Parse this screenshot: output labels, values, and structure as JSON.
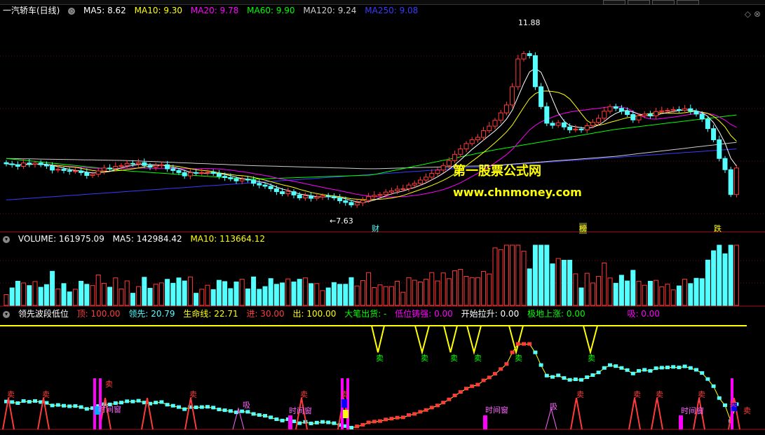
{
  "colors": {
    "up": "#ff3c3c",
    "down": "#54ffff",
    "ma5": "#ffffff",
    "ma10": "#ffff00",
    "ma20": "#ff00ff",
    "ma60": "#00ff00",
    "ma120": "#cccccc",
    "ma250": "#3a3aff"
  },
  "main_header": {
    "title": "一汽轿车(日线)",
    "ma5": "MA5: 8.62",
    "ma10": "MA10: 9.30",
    "ma20": "MA20: 9.78",
    "ma60": "MA60: 9.90",
    "ma120": "MA120: 9.24",
    "ma250": "MA250: 9.08"
  },
  "vol_header": {
    "volume": "VOLUME: 161975.09",
    "ma5": "MA5: 142984.42",
    "ma10": "MA10: 113664.12"
  },
  "ind_header": {
    "name": "领先波段低位",
    "top": "顶: 100.00",
    "lead": "领先: 20.79",
    "life": "生命线: 22.71",
    "in": "进: 30.00",
    "out": "出: 100.00",
    "big": "大笔出货: -",
    "low": "低位铸强: 0.00",
    "start": "开始拉升: 0.00",
    "bottom": "极地上涨: 0.00",
    "absorb": "吸: 0.00"
  },
  "watermark": {
    "line1": "第一股票公式网",
    "line2": "www.chnmoney.com"
  },
  "annotations": {
    "high": "11.88",
    "low": "←7.63",
    "cai": "财",
    "bang": "榜",
    "die": "跌"
  },
  "sell_labels_top": [
    "卖",
    "卖",
    "卖",
    "卖",
    "卖",
    "卖"
  ],
  "sell_labels_bottom": [
    "卖",
    "卖",
    "卖",
    "卖",
    "卖",
    "卖",
    "卖",
    "卖",
    "卖",
    "卖",
    "卖",
    "卖"
  ],
  "window_labels": [
    "时间窗",
    "时间窗",
    "时间窗",
    "时间窗",
    "时间窗"
  ],
  "absorb_labels": [
    "吸",
    "吸"
  ],
  "chart_data": [
    {
      "type": "candlestick",
      "title": "一汽轿车(日线)",
      "ylim": [
        7.3,
        12.3
      ],
      "close": [
        8.72,
        8.7,
        8.66,
        8.74,
        8.71,
        8.74,
        8.7,
        8.67,
        8.57,
        8.59,
        8.56,
        8.54,
        8.55,
        8.51,
        8.44,
        8.47,
        8.55,
        8.62,
        8.61,
        8.66,
        8.68,
        8.73,
        8.72,
        8.75,
        8.68,
        8.64,
        8.68,
        8.7,
        8.6,
        8.56,
        8.51,
        8.43,
        8.51,
        8.5,
        8.51,
        8.52,
        8.49,
        8.42,
        8.39,
        8.36,
        8.31,
        8.35,
        8.33,
        8.25,
        8.21,
        8.18,
        8.12,
        8.05,
        8.0,
        8.05,
        7.97,
        7.9,
        7.95,
        7.89,
        7.92,
        7.95,
        7.93,
        7.9,
        7.83,
        7.79,
        7.73,
        7.78,
        7.84,
        7.93,
        7.96,
        7.98,
        8.04,
        8.07,
        8.11,
        8.12,
        8.21,
        8.25,
        8.33,
        8.4,
        8.49,
        8.57,
        8.68,
        8.8,
        8.95,
        9.08,
        9.21,
        9.3,
        9.36,
        9.52,
        9.63,
        9.77,
        9.95,
        10.14,
        10.58,
        11.25,
        11.38,
        11.33,
        10.58,
        10.1,
        9.7,
        9.65,
        9.71,
        9.61,
        9.54,
        9.56,
        9.54,
        9.64,
        9.72,
        9.82,
        9.99,
        10.1,
        10.06,
        9.99,
        9.91,
        9.78,
        9.88,
        9.92,
        9.88,
        9.98,
        10.0,
        10.01,
        10.03,
        10.01,
        10.05,
        9.99,
        9.92,
        9.8,
        9.57,
        9.3,
        8.85,
        8.58,
        7.98,
        8.62
      ],
      "notes": "approximate daily closes read from the price axis; left-side values estimated"
    },
    {
      "type": "bar",
      "title": "VOLUME",
      "series": [
        {
          "name": "VOLUME",
          "last": 161975.09
        },
        {
          "name": "MA5",
          "last": 142984.42
        },
        {
          "name": "MA10",
          "last": 113664.12
        }
      ]
    },
    {
      "type": "line",
      "title": "领先波段低位",
      "series": [
        {
          "name": "领先",
          "last": 20.79
        },
        {
          "name": "生命线",
          "last": 22.71
        },
        {
          "name": "顶",
          "last": 100.0
        }
      ]
    }
  ]
}
